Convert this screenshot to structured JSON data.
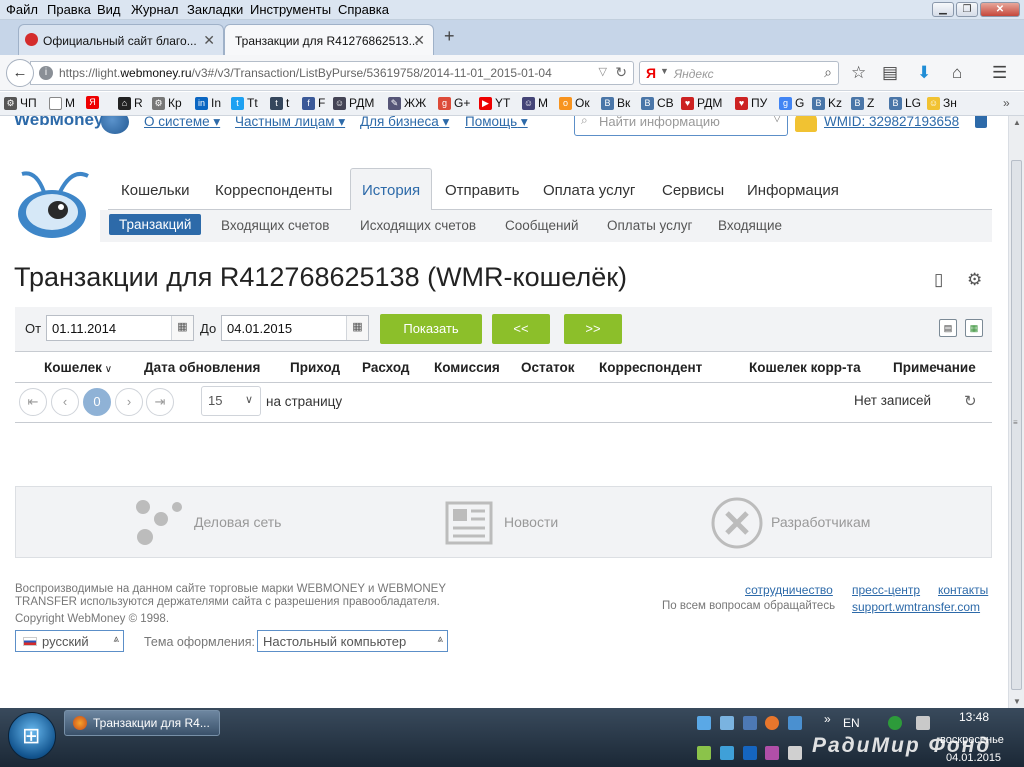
{
  "browser": {
    "menu": [
      "Файл",
      "Правка",
      "Вид",
      "Журнал",
      "Закладки",
      "Инструменты",
      "Справка"
    ],
    "tabs": [
      {
        "title": "Официальный сайт благо...",
        "active": false
      },
      {
        "title": "Транзакции для R41276862513...",
        "active": true
      }
    ],
    "new_tab": "+",
    "url": {
      "prefix": "https://light.",
      "host": "webmoney.ru",
      "path": "/v3#/v3/Transaction/ListByPurse/53619758/2014-11-01_2015-01-04"
    },
    "search": {
      "engine": "Я",
      "placeholder": "Яндекс"
    },
    "bookmarks": [
      "ЧП",
      "М",
      "R",
      "Кр",
      "In",
      "Tt",
      "t",
      "F",
      "РДМ",
      "ЖЖ",
      "G+",
      "YT",
      "М",
      "Ок",
      "Вк",
      "СВ",
      "РДМ",
      "ПУ",
      "G",
      "Kz",
      "Z",
      "LG",
      "Зн"
    ]
  },
  "site": {
    "logo": "WebMoney",
    "top_menu": [
      "О системе",
      "Частным лицам",
      "Для бизнеса",
      "Помощь"
    ],
    "search_placeholder": "Найти информацию",
    "wmid": "WMID: 329827193658",
    "main_tabs": [
      "Кошельки",
      "Корреспонденты",
      "История",
      "Отправить",
      "Оплата услуг",
      "Сервисы",
      "Информация"
    ],
    "active_main_tab": "История",
    "sub_tabs": [
      "Транзакций",
      "Входящих счетов",
      "Исходящих счетов",
      "Сообщений",
      "Оплаты услуг",
      "Входящие"
    ],
    "active_sub_tab": "Транзакций",
    "title": "Транзакции для R412768625138 (WMR-кошелёк)",
    "filter": {
      "from_label": "От",
      "from_value": "01.11.2014",
      "to_label": "До",
      "to_value": "04.01.2015",
      "show_button": "Показать",
      "prev_button": "<<",
      "next_button": ">>"
    },
    "table": {
      "columns": [
        "Кошелек",
        "Дата обновления",
        "Приход",
        "Расход",
        "Комиссия",
        "Остаток",
        "Корреспондент",
        "Кошелек корр-та",
        "Примечание"
      ]
    },
    "pager": {
      "current_page": "0",
      "per_page": "15",
      "per_page_label": "на страницу",
      "empty_text": "Нет записей"
    },
    "promo": [
      "Деловая сеть",
      "Новости",
      "Разработчикам"
    ],
    "footer": {
      "disclaimer_line1": "Воспроизводимые на данном сайте торговые марки WEBMONEY и WEBMONEY",
      "disclaimer_line2": "TRANSFER используются держателями сайта с разрешения правообладателя.",
      "copyright": "Copyright WebMoney © 1998.",
      "links": [
        "сотрудничество",
        "пресс-центр",
        "контакты"
      ],
      "support_text": "По всем вопросам обращайтесь",
      "support_link": "support.wmtransfer.com",
      "language": "русский",
      "theme_label": "Тема оформления:",
      "theme_value": "Настольный компьютер"
    }
  },
  "taskbar": {
    "task_title": "Транзакции для R4...",
    "language": "EN",
    "time": "13:48",
    "day": "воскресенье",
    "date": "04.01.2015",
    "watermark": "РадиМир Фонд"
  },
  "colors": {
    "brand": "#2d6aa9",
    "button_green": "#8cbf2a",
    "light_bg": "#f2f3f5"
  }
}
